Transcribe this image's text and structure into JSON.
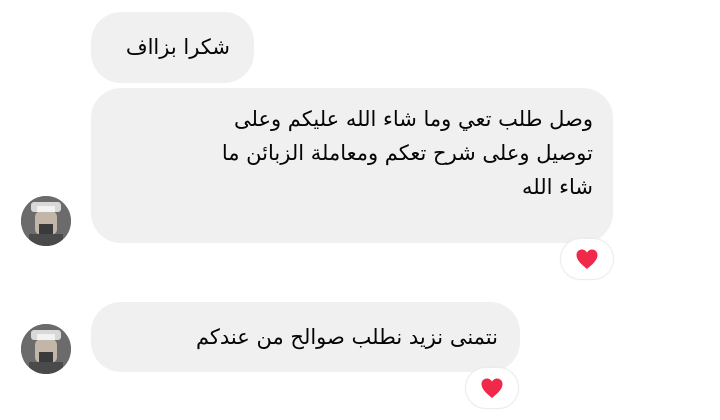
{
  "messages": [
    {
      "text": "شكرا بزااف"
    },
    {
      "lines": [
        "وصل طلب تعي وما شاء الله عليكم وعلى",
        "توصيل وعلى شرح تعكم ومعاملة الزبائن ما",
        "شاء الله"
      ]
    },
    {
      "text": "نتمنى نزيد نطلب صوالح من عندكم"
    }
  ],
  "reactions": [
    {
      "icon": "red-heart",
      "color": "#f0284a"
    },
    {
      "icon": "red-heart",
      "color": "#f0284a"
    }
  ],
  "colors": {
    "bubble": "#f0f0f0",
    "text": "#050505"
  }
}
